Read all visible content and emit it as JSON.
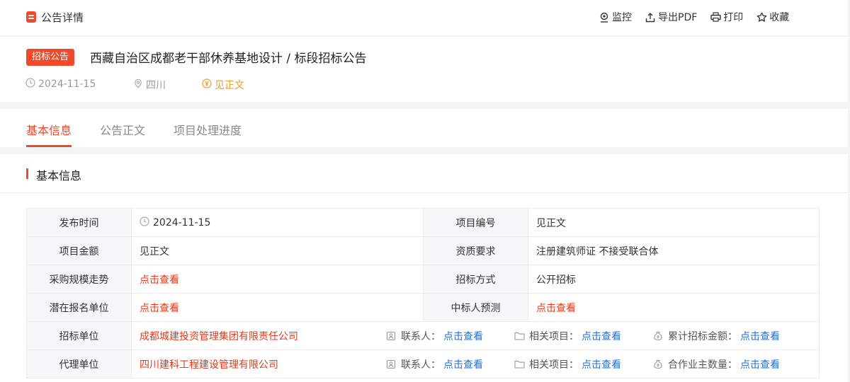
{
  "topbar": {
    "title": "公告详情",
    "actions": [
      {
        "label": "监控",
        "icon": "monitor-pin-icon"
      },
      {
        "label": "导出PDF",
        "icon": "export-icon"
      },
      {
        "label": "打印",
        "icon": "printer-icon"
      },
      {
        "label": "收藏",
        "icon": "star-icon"
      }
    ]
  },
  "header": {
    "tag": "招标公告",
    "title": "西藏自治区成都老干部休养基地设计 / 标段招标公告",
    "date": "2024-11-15",
    "region": "四川",
    "amount": "见正文"
  },
  "tabs": [
    {
      "label": "基本信息",
      "active": true
    },
    {
      "label": "公告正文",
      "active": false
    },
    {
      "label": "项目处理进度",
      "active": false
    }
  ],
  "section": {
    "title": "基本信息"
  },
  "info": {
    "publish_time_label": "发布时间",
    "publish_time": "2024-11-15",
    "project_no_label": "项目编号",
    "project_no": "见正文",
    "amount_label": "项目金额",
    "amount": "见正文",
    "qualification_label": "资质要求",
    "qualification": "注册建筑师证 不接受联合体",
    "trend_label": "采购规模走势",
    "trend": "点击查看",
    "method_label": "招标方式",
    "method": "公开招标",
    "potential_label": "潜在报名单位",
    "potential": "点击查看",
    "winner_label": "中标人预测",
    "winner": "点击查看",
    "tenderer_label": "招标单位",
    "tenderer": "成都城建投资管理集团有限责任公司",
    "tenderer_contact_label": "联系人：",
    "tenderer_contact": "点击查看",
    "tenderer_related_label": "相关项目：",
    "tenderer_related": "点击查看",
    "tenderer_total_label": "累计招标金额：",
    "tenderer_total": "点击查看",
    "agent_label": "代理单位",
    "agent": "四川建科工程建设管理有限公司",
    "agent_contact_label": "联系人：",
    "agent_contact": "点击查看",
    "agent_related_label": "相关项目：",
    "agent_related": "点击查看",
    "agent_partners_label": "合作业主数量：",
    "agent_partners": "点击查看"
  },
  "colors": {
    "accent": "#ef4a2c",
    "link_blue": "#2c6ecb",
    "price_orange": "#f09a2a"
  }
}
